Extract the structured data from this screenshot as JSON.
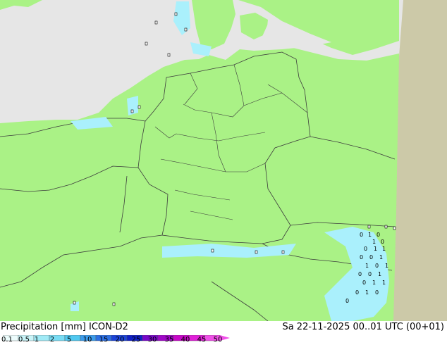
{
  "title": "Precipitation [mm]",
  "model": "ICON-D2",
  "valid_time": "Sa 22-11-2025 00..01 UTC (00+01)",
  "legend": {
    "ticks": [
      "0.1",
      "0.5",
      "1",
      "2",
      "5",
      "10",
      "15",
      "20",
      "25",
      "30",
      "35",
      "40",
      "45",
      "50"
    ],
    "colors": [
      "#ecfcfc",
      "#c8f4f8",
      "#a0eaf6",
      "#78dcf4",
      "#50c8f0",
      "#3c9cec",
      "#2c70e4",
      "#1c44d8",
      "#1020c4",
      "#7808c8",
      "#a008c8",
      "#c808c8",
      "#e020d8",
      "#f050e8"
    ]
  },
  "colors": {
    "land": "#aaf286",
    "sea": "#e6e6e6",
    "outside_domain": "#ccc9a8",
    "borders": "#3c3c3c",
    "precip_light": "#aaf0fc"
  },
  "grid_annotations": [
    "0",
    "1",
    "0",
    "1",
    "0",
    "0",
    "1",
    "1",
    "0",
    "0",
    "1",
    "1",
    "0",
    "1",
    "0",
    "0",
    "1",
    "0",
    "1",
    "1",
    "0",
    "1",
    "0",
    "0"
  ]
}
